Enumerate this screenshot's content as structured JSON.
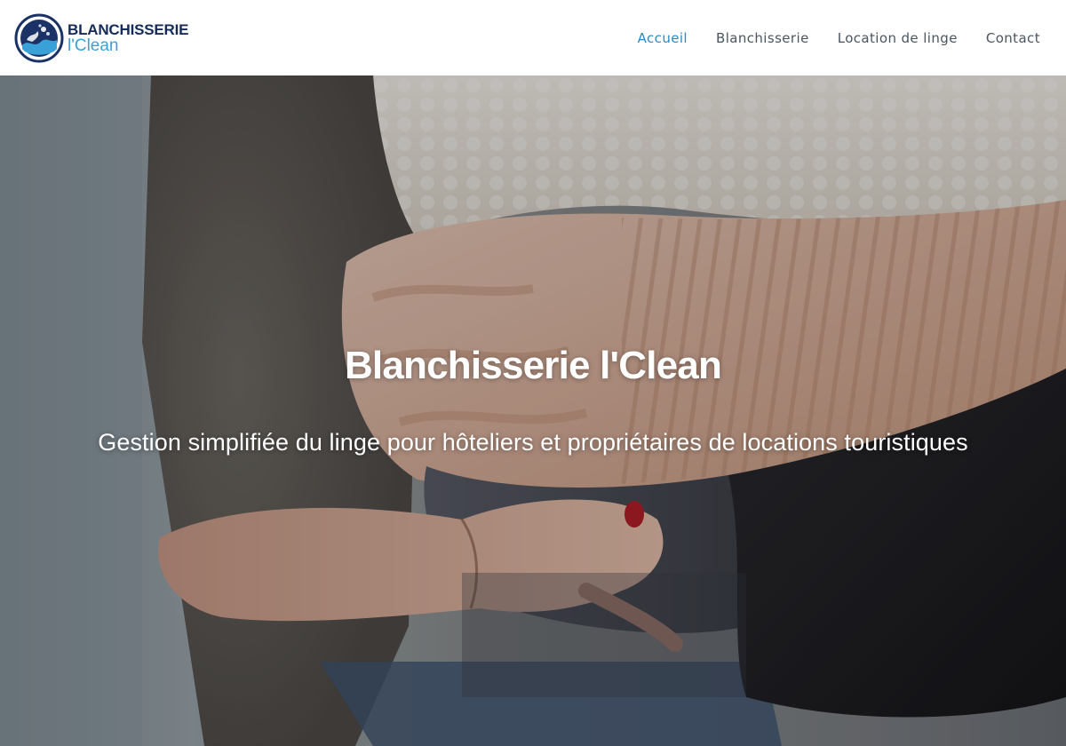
{
  "header": {
    "logo": {
      "line1": "BLANCHISSERIE",
      "line2": "l'Clean",
      "icon": "laundry-wave-logo"
    },
    "nav": [
      {
        "label": "Accueil",
        "active": true
      },
      {
        "label": "Blanchisserie",
        "active": false
      },
      {
        "label": "Location de linge",
        "active": false
      },
      {
        "label": "Contact",
        "active": false
      }
    ]
  },
  "hero": {
    "title": "Blanchisserie l'Clean",
    "subtitle": "Gestion simplifiée du linge pour hôteliers et propriétaires de locations touristiques",
    "background": "person-holding-folded-knit-sweaters-photo"
  },
  "colors": {
    "accent": "#2a8bc4",
    "brand_dark": "#152b5a",
    "brand_light": "#3aa0d8",
    "nav_text": "#4a5560"
  }
}
